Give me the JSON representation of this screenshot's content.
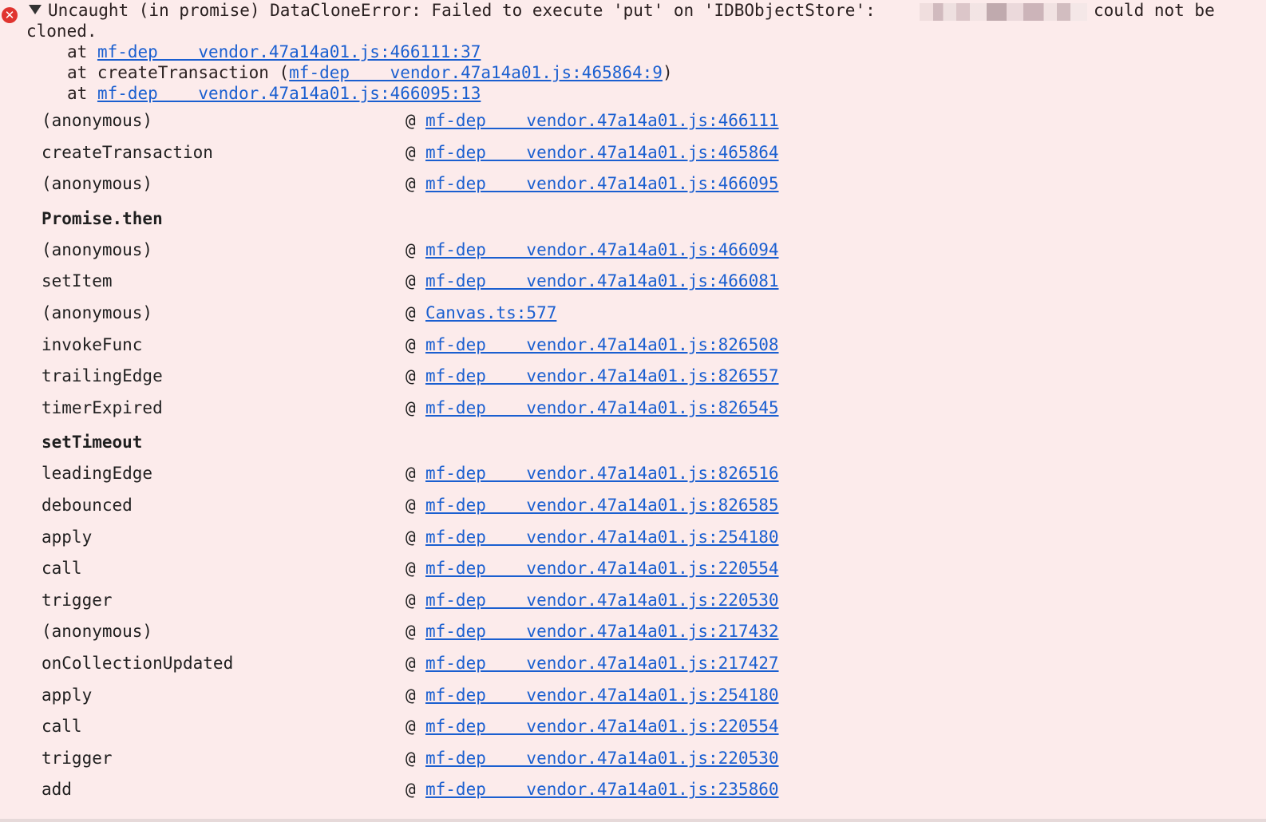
{
  "console": {
    "error_icon_name": "error-icon",
    "error_icon_glyph": "✕",
    "message_line1": "Uncaught (in promise) DataCloneError: Failed to execute 'put' on 'IDBObjectStore':",
    "message_tail": "could not be",
    "message_line2": "cloned.",
    "at_lines": [
      {
        "prefix": "at ",
        "fn": "",
        "link": "mf-dep    vendor.47a14a01.js:466111:37",
        "suffix": ""
      },
      {
        "prefix": "at ",
        "fn": "createTransaction (",
        "link": "mf-dep    vendor.47a14a01.js:465864:9",
        "suffix": ")"
      },
      {
        "prefix": "at ",
        "fn": "",
        "link": "mf-dep    vendor.47a14a01.js:466095:13",
        "suffix": ""
      }
    ],
    "at_symbol": "@",
    "frames": [
      {
        "fn": "(anonymous)",
        "loc": "mf-dep    vendor.47a14a01.js:466111"
      },
      {
        "fn": "createTransaction",
        "loc": "mf-dep    vendor.47a14a01.js:465864"
      },
      {
        "fn": "(anonymous)",
        "loc": "mf-dep    vendor.47a14a01.js:466095"
      },
      {
        "async": "Promise.then"
      },
      {
        "fn": "(anonymous)",
        "loc": "mf-dep    vendor.47a14a01.js:466094"
      },
      {
        "fn": "setItem",
        "loc": "mf-dep    vendor.47a14a01.js:466081"
      },
      {
        "fn": "(anonymous)",
        "loc": "Canvas.ts:577"
      },
      {
        "fn": "invokeFunc",
        "loc": "mf-dep    vendor.47a14a01.js:826508"
      },
      {
        "fn": "trailingEdge",
        "loc": "mf-dep    vendor.47a14a01.js:826557"
      },
      {
        "fn": "timerExpired",
        "loc": "mf-dep    vendor.47a14a01.js:826545"
      },
      {
        "async": "setTimeout"
      },
      {
        "fn": "leadingEdge",
        "loc": "mf-dep    vendor.47a14a01.js:826516"
      },
      {
        "fn": "debounced",
        "loc": "mf-dep    vendor.47a14a01.js:826585"
      },
      {
        "fn": "apply",
        "loc": "mf-dep    vendor.47a14a01.js:254180"
      },
      {
        "fn": "call",
        "loc": "mf-dep    vendor.47a14a01.js:220554"
      },
      {
        "fn": "trigger",
        "loc": "mf-dep    vendor.47a14a01.js:220530"
      },
      {
        "fn": "(anonymous)",
        "loc": "mf-dep    vendor.47a14a01.js:217432"
      },
      {
        "fn": "onCollectionUpdated",
        "loc": "mf-dep    vendor.47a14a01.js:217427"
      },
      {
        "fn": "apply",
        "loc": "mf-dep    vendor.47a14a01.js:254180"
      },
      {
        "fn": "call",
        "loc": "mf-dep    vendor.47a14a01.js:220554"
      },
      {
        "fn": "trigger",
        "loc": "mf-dep    vendor.47a14a01.js:220530"
      },
      {
        "fn": "add",
        "loc": "mf-dep    vendor.47a14a01.js:235860"
      }
    ]
  }
}
